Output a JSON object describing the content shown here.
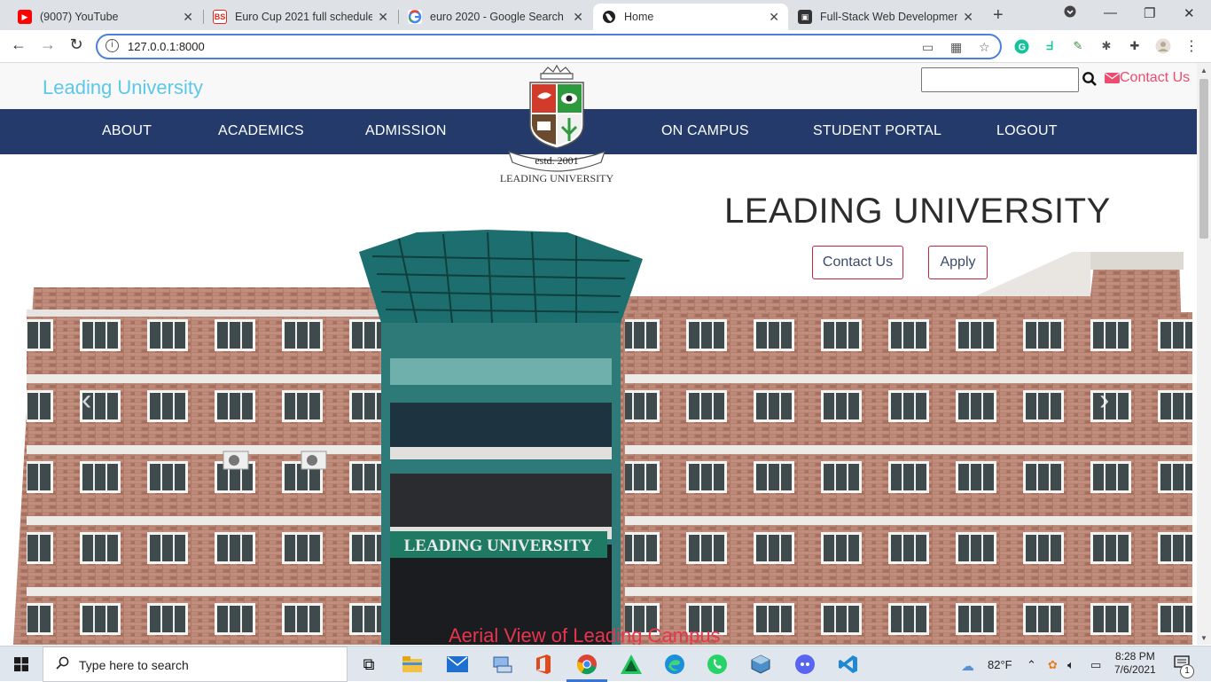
{
  "browser": {
    "tabs": [
      {
        "title": "(9007) YouTube",
        "icon": "youtube-icon",
        "color": "#ff0000"
      },
      {
        "title": "Euro Cup 2021 full schedule,",
        "icon": "bs-icon",
        "color": "#d92a1d"
      },
      {
        "title": "euro 2020 - Google Search",
        "icon": "google-icon",
        "color": "#4285f4"
      },
      {
        "title": "Home",
        "icon": "globe-icon",
        "color": "#202124"
      },
      {
        "title": "Full-Stack Web Development",
        "icon": "course-icon",
        "color": "#333333"
      }
    ],
    "url": "127.0.0.1:8000"
  },
  "site": {
    "brand": "Leading University",
    "header_contact": "Contact Us",
    "nav": [
      "ABOUT",
      "ACADEMICS",
      "ADMISSION",
      "ON CAMPUS",
      "STUDENT PORTAL",
      "LOGOUT"
    ],
    "logo_text_estd": "estd. 2001",
    "logo_text_name": "LEADING UNIVERSITY",
    "hero": {
      "title": "LEADING UNIVERSITY",
      "contact_button": "Contact Us",
      "apply_button": "Apply",
      "caption": "Aerial View of Leading Campus",
      "building_sign": "LEADING UNIVERSITY"
    }
  },
  "taskbar": {
    "search_placeholder": "Type here to search",
    "weather": "82°F",
    "time": "8:28 PM",
    "date": "7/6/2021",
    "notification_count": "1"
  },
  "colors": {
    "nav_bg": "#233a6b",
    "brand": "#5bc8e8",
    "accent": "#ee4c6e",
    "caption": "#e8344c"
  }
}
